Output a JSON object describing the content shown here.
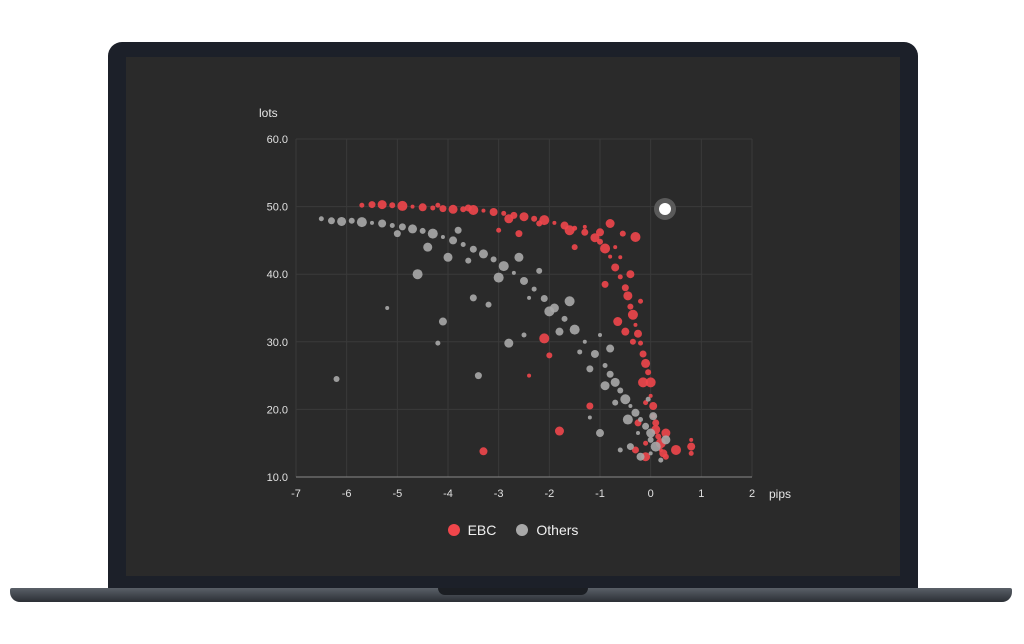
{
  "colors": {
    "ebc": "#f0464b",
    "others": "#a8a8a8",
    "grid": "#3a3a3a",
    "axis": "#8a8a8a",
    "text": "#e0e0e0"
  },
  "chart_data": {
    "type": "scatter",
    "title": "",
    "xlabel": "pips",
    "ylabel": "lots",
    "xlim": [
      -7,
      2
    ],
    "ylim": [
      10,
      60
    ],
    "x_ticks": [
      "-7",
      "-6",
      "-5",
      "-4",
      "-3",
      "-2",
      "-1",
      "0",
      "1",
      "2"
    ],
    "y_ticks": [
      "10.0",
      "20.0",
      "30.0",
      "40.0",
      "50.0",
      "60.0"
    ],
    "legend_position": "bottom-center",
    "series": [
      {
        "name": "EBC",
        "points": [
          [
            -5.7,
            50.2
          ],
          [
            -5.5,
            50.3
          ],
          [
            -5.3,
            50.3
          ],
          [
            -5.1,
            50.2
          ],
          [
            -4.9,
            50.1
          ],
          [
            -4.7,
            50.0
          ],
          [
            -4.5,
            49.9
          ],
          [
            -4.3,
            49.8
          ],
          [
            -4.1,
            49.7
          ],
          [
            -3.9,
            49.6
          ],
          [
            -3.7,
            49.6
          ],
          [
            -3.5,
            49.5
          ],
          [
            -3.3,
            49.4
          ],
          [
            -3.1,
            49.2
          ],
          [
            -2.9,
            49.0
          ],
          [
            -2.7,
            48.7
          ],
          [
            -2.5,
            48.5
          ],
          [
            -2.3,
            48.2
          ],
          [
            -2.1,
            48.0
          ],
          [
            -1.9,
            47.6
          ],
          [
            -1.7,
            47.2
          ],
          [
            -1.5,
            46.8
          ],
          [
            -1.3,
            46.2
          ],
          [
            -1.1,
            45.4
          ],
          [
            -1.0,
            44.8
          ],
          [
            -0.9,
            43.8
          ],
          [
            -0.8,
            42.6
          ],
          [
            -0.7,
            41.0
          ],
          [
            -0.6,
            39.6
          ],
          [
            -0.5,
            38.0
          ],
          [
            -0.45,
            36.8
          ],
          [
            -0.4,
            35.2
          ],
          [
            -0.35,
            34.0
          ],
          [
            -0.3,
            32.5
          ],
          [
            -0.25,
            31.2
          ],
          [
            -0.2,
            29.8
          ],
          [
            -0.15,
            28.2
          ],
          [
            -0.1,
            26.8
          ],
          [
            -0.05,
            25.5
          ],
          [
            0.0,
            24.0
          ],
          [
            0.0,
            22.0
          ],
          [
            0.05,
            20.5
          ],
          [
            0.05,
            19.0
          ],
          [
            0.1,
            18.0
          ],
          [
            0.1,
            17.0
          ],
          [
            0.15,
            16.0
          ],
          [
            0.2,
            15.0
          ],
          [
            0.2,
            14.0
          ],
          [
            0.25,
            13.5
          ],
          [
            -0.1,
            15.0
          ],
          [
            -0.3,
            14.0
          ],
          [
            -0.1,
            13.0
          ],
          [
            0.3,
            13.0
          ],
          [
            0.5,
            14.0
          ],
          [
            0.8,
            15.5
          ],
          [
            0.8,
            14.5
          ],
          [
            0.8,
            13.5
          ],
          [
            -1.2,
            20.5
          ],
          [
            -1.8,
            16.8
          ],
          [
            -2.0,
            28.0
          ],
          [
            -2.1,
            30.5
          ],
          [
            -2.4,
            25.0
          ],
          [
            -3.3,
            13.8
          ],
          [
            -3.0,
            46.5
          ],
          [
            -2.6,
            46.0
          ],
          [
            -0.8,
            47.5
          ],
          [
            -0.55,
            46.0
          ],
          [
            -0.3,
            45.5
          ],
          [
            -0.7,
            44.0
          ],
          [
            -0.4,
            40.0
          ],
          [
            -0.2,
            36.0
          ],
          [
            -0.9,
            38.5
          ],
          [
            -0.65,
            33.0
          ],
          [
            -0.35,
            30.0
          ],
          [
            -0.15,
            24.0
          ],
          [
            -1.3,
            47.0
          ],
          [
            -1.0,
            46.2
          ],
          [
            -4.2,
            50.2
          ],
          [
            -3.6,
            49.8
          ],
          [
            -2.8,
            48.2
          ],
          [
            -2.2,
            47.5
          ],
          [
            -1.6,
            46.5
          ],
          [
            -0.6,
            42.5
          ],
          [
            -0.5,
            31.5
          ],
          [
            -0.1,
            21.0
          ],
          [
            -0.25,
            18.0
          ],
          [
            0.3,
            16.5
          ],
          [
            -1.5,
            44.0
          ]
        ]
      },
      {
        "name": "Others",
        "points": [
          [
            -6.5,
            48.2
          ],
          [
            -6.3,
            47.9
          ],
          [
            -6.1,
            47.8
          ],
          [
            -5.9,
            47.9
          ],
          [
            -5.7,
            47.7
          ],
          [
            -5.5,
            47.6
          ],
          [
            -5.3,
            47.5
          ],
          [
            -5.1,
            47.2
          ],
          [
            -4.9,
            47.0
          ],
          [
            -4.7,
            46.7
          ],
          [
            -4.5,
            46.4
          ],
          [
            -4.3,
            46.0
          ],
          [
            -4.1,
            45.5
          ],
          [
            -3.9,
            45.0
          ],
          [
            -3.7,
            44.4
          ],
          [
            -3.5,
            43.7
          ],
          [
            -3.3,
            43.0
          ],
          [
            -3.1,
            42.2
          ],
          [
            -2.9,
            41.2
          ],
          [
            -2.7,
            40.2
          ],
          [
            -2.5,
            39.0
          ],
          [
            -2.3,
            37.8
          ],
          [
            -2.1,
            36.4
          ],
          [
            -1.9,
            35.0
          ],
          [
            -1.7,
            33.4
          ],
          [
            -1.5,
            31.8
          ],
          [
            -1.3,
            30.0
          ],
          [
            -1.1,
            28.2
          ],
          [
            -0.9,
            26.5
          ],
          [
            -0.8,
            25.2
          ],
          [
            -0.7,
            24.0
          ],
          [
            -0.6,
            22.8
          ],
          [
            -0.5,
            21.5
          ],
          [
            -0.4,
            20.5
          ],
          [
            -0.3,
            19.5
          ],
          [
            -0.2,
            18.5
          ],
          [
            -0.1,
            17.5
          ],
          [
            0.0,
            16.5
          ],
          [
            0.0,
            15.5
          ],
          [
            0.1,
            14.5
          ],
          [
            0.0,
            13.5
          ],
          [
            -0.2,
            13.0
          ],
          [
            0.2,
            12.5
          ],
          [
            -0.4,
            14.5
          ],
          [
            0.3,
            15.5
          ],
          [
            -6.2,
            24.5
          ],
          [
            -4.6,
            40.0
          ],
          [
            -5.2,
            35.0
          ],
          [
            -4.1,
            33.0
          ],
          [
            -4.2,
            29.8
          ],
          [
            -3.4,
            25.0
          ],
          [
            -2.8,
            29.8
          ],
          [
            -3.2,
            35.5
          ],
          [
            -2.0,
            34.5
          ],
          [
            -1.2,
            18.8
          ],
          [
            -1.0,
            16.5
          ],
          [
            -0.6,
            14.0
          ],
          [
            -5.0,
            46.0
          ],
          [
            -4.4,
            44.0
          ],
          [
            -3.6,
            42.0
          ],
          [
            -3.0,
            39.5
          ],
          [
            -2.4,
            36.5
          ],
          [
            -1.8,
            31.5
          ],
          [
            -1.4,
            28.5
          ],
          [
            -1.2,
            26.0
          ],
          [
            -0.9,
            23.5
          ],
          [
            -0.7,
            21.0
          ],
          [
            -0.45,
            18.5
          ],
          [
            -0.25,
            16.5
          ],
          [
            0.05,
            19.0
          ],
          [
            -0.05,
            21.5
          ],
          [
            -3.8,
            46.5
          ],
          [
            -2.6,
            42.5
          ],
          [
            -2.2,
            40.5
          ],
          [
            -1.6,
            36.0
          ],
          [
            -1.0,
            31.0
          ],
          [
            -0.8,
            29.0
          ],
          [
            -2.5,
            31.0
          ],
          [
            -3.5,
            36.5
          ],
          [
            -4.0,
            42.5
          ]
        ]
      }
    ]
  }
}
